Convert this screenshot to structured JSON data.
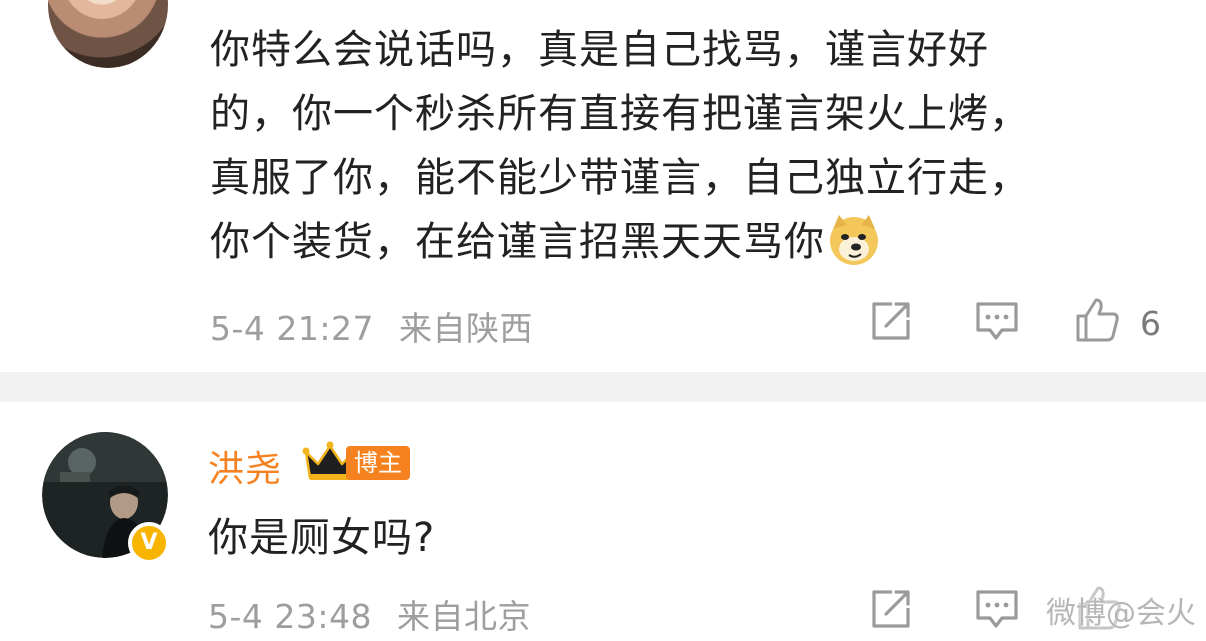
{
  "comment1": {
    "lines": [
      "你特么会说话吗，真是自己找骂，谨言好好",
      "的，你一个秒杀所有直接有把谨言架火上烤，",
      "真服了你，能不能少带谨言，自己独立行走，",
      "你个装货，在给谨言招黑天天骂你"
    ],
    "emoji": "doge-emoji",
    "timestamp": "5-4 21:27",
    "location": "来自陕西",
    "like_count": "6"
  },
  "comment2": {
    "username": "洪尧",
    "badge": "博主",
    "verified_mark": "V",
    "text": "你是厕女吗?",
    "timestamp": "5-4 23:48",
    "location": "来自北京"
  },
  "watermark": "微博@会火",
  "colors": {
    "username": "#f5821f",
    "meta_text": "#9e9e9e",
    "divider": "#f2f2f2",
    "verified": "#f7b500"
  }
}
